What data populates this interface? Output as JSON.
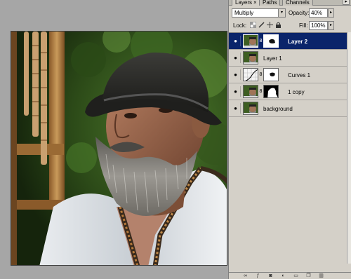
{
  "palette": {
    "tabs": [
      {
        "label": "Layers",
        "close": "×"
      },
      {
        "label": "Paths"
      },
      {
        "label": "Channels"
      }
    ],
    "menu_glyph": "▸",
    "blend_mode": "Multiply",
    "opacity_label": "Opacity:",
    "opacity_value": "40%",
    "lock_label": "Lock:",
    "fill_label": "Fill:",
    "fill_value": "100%",
    "arrow_glyph": "▸",
    "dropdown_glyph": "▾",
    "eye_glyph": "●",
    "chain_glyph": "8",
    "layers": [
      {
        "name": "Layer 2",
        "selected": true,
        "has_mask": true
      },
      {
        "name": "Layer 1",
        "selected": false,
        "has_mask": false
      },
      {
        "name": "Curves 1",
        "selected": false,
        "has_mask": true,
        "adjustment": true
      },
      {
        "name": "1 copy",
        "selected": false,
        "has_mask": true
      },
      {
        "name": "background",
        "selected": false,
        "has_mask": false
      }
    ]
  },
  "icons": {
    "lock_transparency": "checker-icon",
    "lock_brush": "brush-icon",
    "lock_move": "move-icon",
    "lock_all": "lock-icon",
    "bottom": [
      "link-icon",
      "fx-icon",
      "mask-icon",
      "adjustment-icon",
      "folder-icon",
      "new-layer-icon",
      "trash-icon"
    ]
  },
  "colors": {
    "selected_bg": "#0a246a",
    "panel_bg": "#d4d0c8",
    "canvas_bg": "#a6a6a6"
  }
}
